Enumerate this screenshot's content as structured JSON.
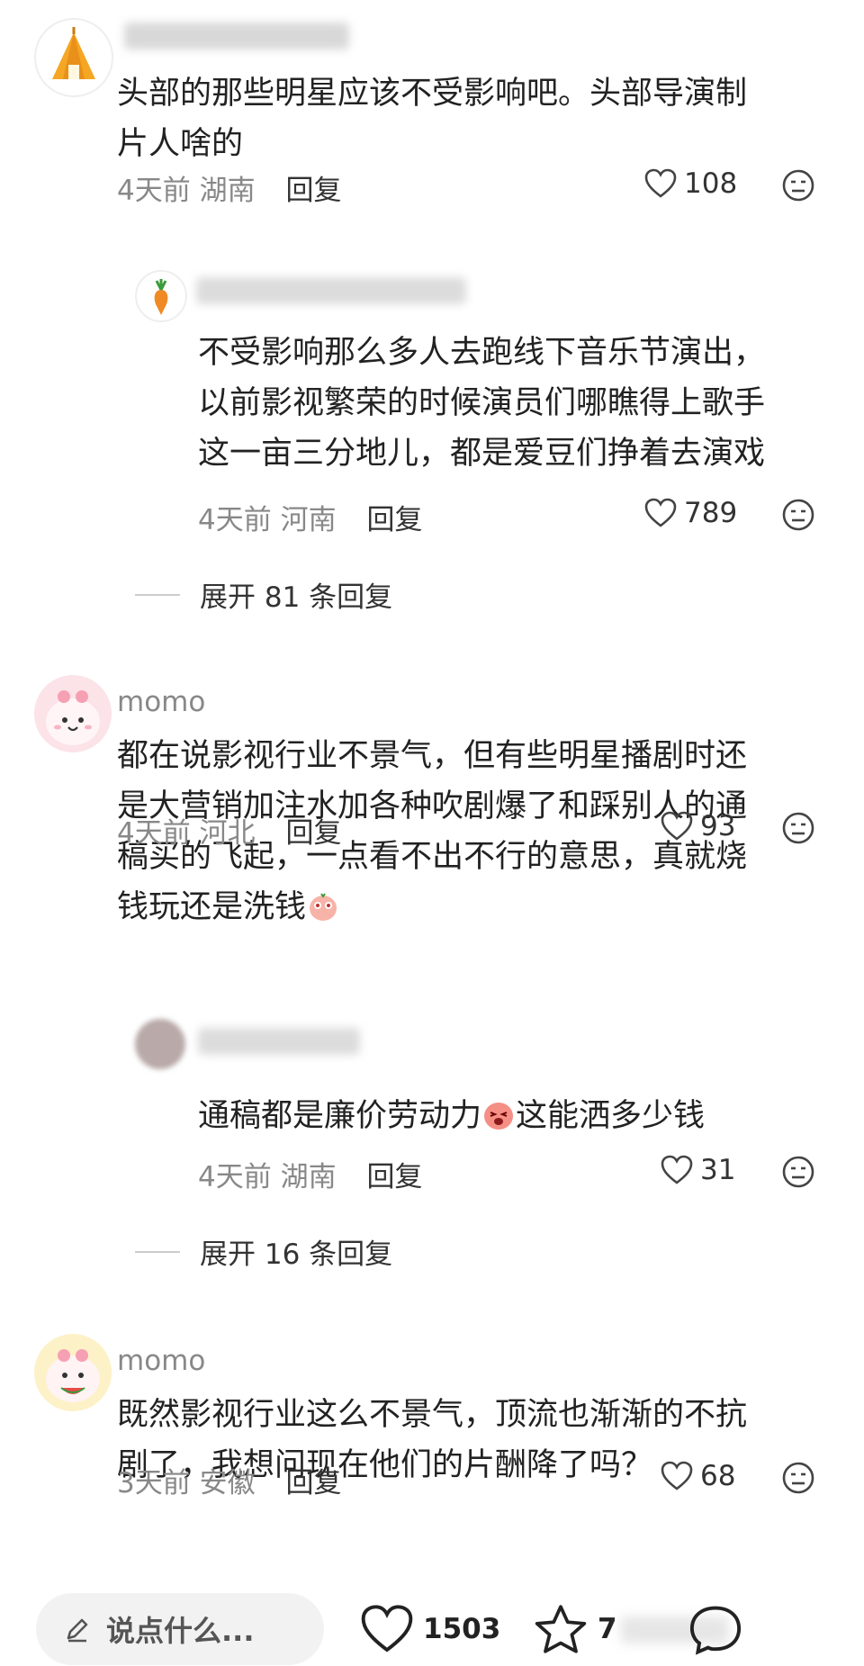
{
  "comments": [
    {
      "username": "",
      "text_lines": [
        "头部的那些明星应该不受影响吧。头部导演制",
        "片人啥的"
      ],
      "time": "4天前",
      "location": "湖南",
      "reply_label": "回复",
      "likes": "108",
      "reply": {
        "username": "",
        "text_lines": [
          "不受影响那么多人去跑线下音乐节演出，",
          "以前影视繁荣的时候演员们哪瞧得上歌手",
          "这一亩三分地儿，都是爱豆们挣着去演戏"
        ],
        "time": "4天前",
        "location": "河南",
        "reply_label": "回复",
        "likes": "789"
      },
      "expand_label": "展开 81 条回复"
    },
    {
      "username": "momo",
      "text_lines": [
        "都在说影视行业不景气，但有些明星播剧时还",
        "是大营销加注水加各种吹剧爆了和踩别人的通",
        "稿买的飞起，一点看不出不行的意思，真就烧",
        "钱玩还是洗钱"
      ],
      "time": "4天前",
      "location": "河北",
      "reply_label": "回复",
      "likes": "93",
      "reply": {
        "username": "",
        "text_part1": "通稿都是廉价劳动力",
        "text_part2": "这能洒多少钱",
        "time": "4天前",
        "location": "湖南",
        "reply_label": "回复",
        "likes": "31"
      },
      "expand_label": "展开 16 条回复"
    },
    {
      "username": "momo",
      "text_lines": [
        "既然影视行业这么不景气，顶流也渐渐的不抗",
        "剧了，我想问现在他们的片酬降了吗？"
      ],
      "time": "3天前",
      "location": "安徽",
      "reply_label": "回复",
      "likes": "68"
    }
  ],
  "bottom_bar": {
    "input_placeholder": "说点什么...",
    "like_count": "1503",
    "star_count": "7"
  },
  "colors": {
    "text": "#222222",
    "meta": "#888888",
    "divider": "#cccccc"
  }
}
